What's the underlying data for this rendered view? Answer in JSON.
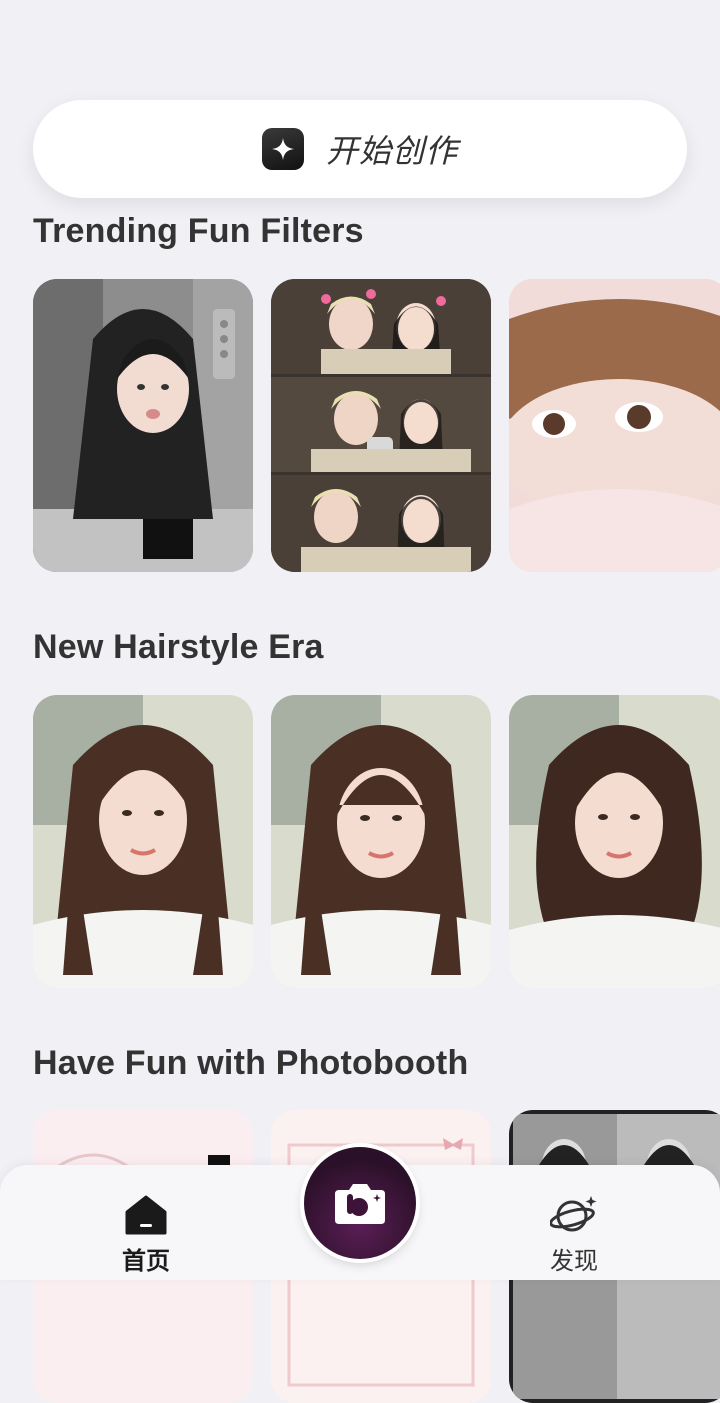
{
  "start_button": {
    "label": "开始创作",
    "icon": "sparkle-icon"
  },
  "sections": [
    {
      "title": "Trending Fun Filters",
      "cards": [
        "elevator-pout-photo",
        "couple-photobooth-strip",
        "eye-closeup-photo"
      ]
    },
    {
      "title": "New Hairstyle Era",
      "cards": [
        "crimped-hair-photo",
        "crimped-bangs-photo",
        "wavy-layers-photo"
      ]
    },
    {
      "title": "Have Fun with Photobooth",
      "cards": [
        "pink-frame-photo",
        "pink-bow-frame-photo",
        "bw-photobooth-photo"
      ]
    }
  ],
  "bottom_nav": {
    "home": {
      "label": "首页",
      "icon": "home-icon"
    },
    "camera": {
      "icon": "camera-icon"
    },
    "discover": {
      "label": "发现",
      "icon": "planet-icon"
    }
  },
  "colors": {
    "background": "#f1f0f5",
    "camera_button": "#3d1438",
    "card_text": "#333333"
  }
}
